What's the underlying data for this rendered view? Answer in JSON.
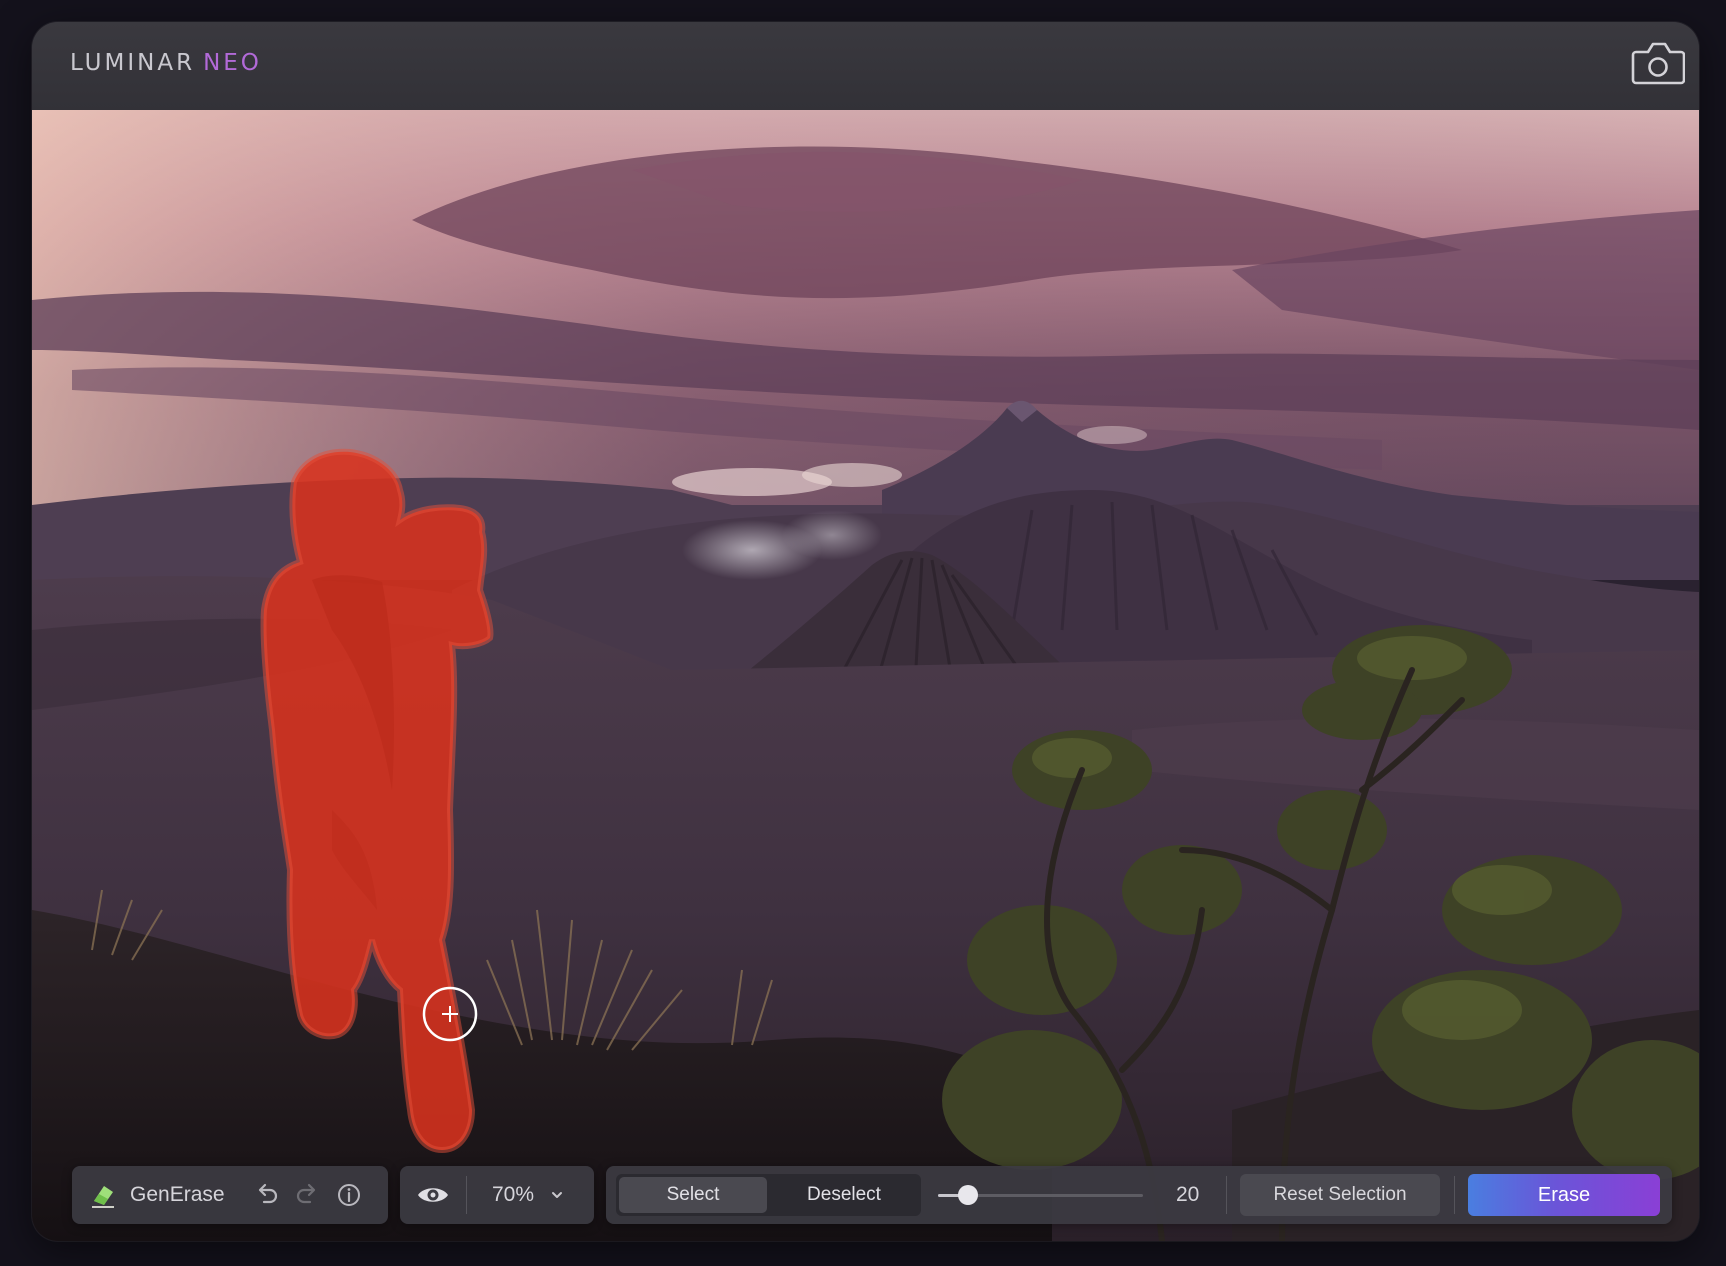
{
  "app": {
    "logo_main": "LUMINAR",
    "logo_accent": "NEO",
    "accent_color": "#b26ad8",
    "camera_icon": "camera-icon"
  },
  "toolbar": {
    "tool_icon": "eraser-icon",
    "tool_name": "GenErase",
    "undo_icon": "undo-icon",
    "redo_icon": "redo-icon",
    "info_icon": "info-icon",
    "eye_icon": "eye-icon",
    "zoom": "70%",
    "zoom_chevron_icon": "chevron-down-icon",
    "select_label": "Select",
    "deselect_label": "Deselect",
    "brush_size": "20",
    "reset_label": "Reset Selection",
    "erase_label": "Erase",
    "erase_gradient": [
      "#4a7ee0",
      "#8a3fd6"
    ]
  },
  "canvas": {
    "cursor_icon": "brush-crosshair-icon",
    "mask_color": "#d8321e"
  }
}
